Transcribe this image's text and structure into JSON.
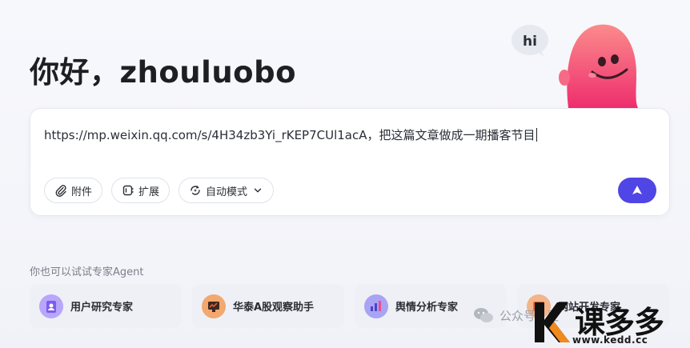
{
  "header": {
    "greeting": "你好，zhouluobo",
    "mascot_bubble": "hi"
  },
  "composer": {
    "prompt_text": "https://mp.weixin.qq.com/s/4H34zb3Yi_rKEP7CUl1acA，把这篇文章做成一期播客节目",
    "attach_label": "附件",
    "extend_label": "扩展",
    "mode_label": "自动模式",
    "send_icon": "arrow-up-icon"
  },
  "experts": {
    "heading": "你也可以试试专家Agent",
    "items": [
      {
        "name": "用户研究专家",
        "color": "#8b6cf6"
      },
      {
        "name": "华泰A股观察助手",
        "color": "#e8833a"
      },
      {
        "name": "舆情分析专家",
        "color": "#5b5bd6"
      },
      {
        "name": "网站开发专家",
        "color": "#e86a2a"
      }
    ]
  },
  "watermark": {
    "text": "公众号 · 夏",
    "brand": "课多多",
    "url": "www.kedd.cc"
  },
  "colors": {
    "accent": "#4f46e5",
    "mascot": "#f0627a"
  }
}
